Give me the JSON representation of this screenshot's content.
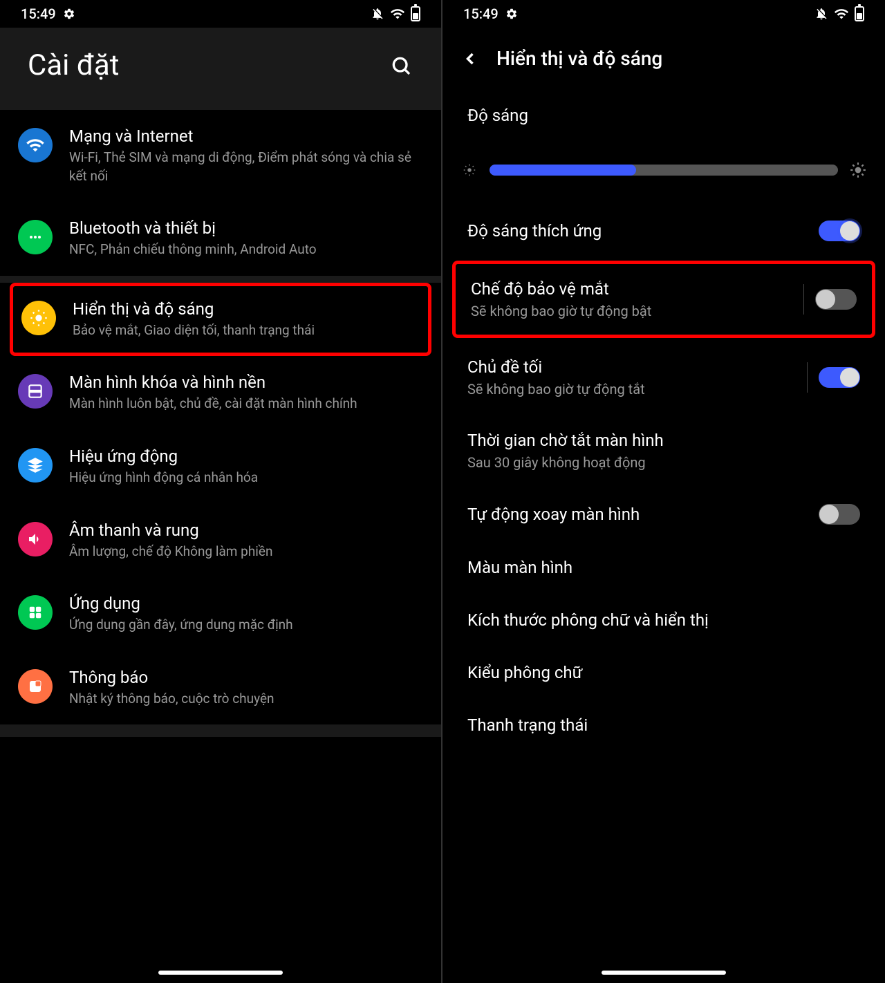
{
  "statusbar": {
    "time": "15:49"
  },
  "left": {
    "title": "Cài đặt",
    "items": [
      {
        "title": "Mạng và Internet",
        "subtitle": "Wi-Fi, Thẻ SIM và mạng di động, Điểm phát sóng và chia sẻ kết nối"
      },
      {
        "title": "Bluetooth và thiết bị",
        "subtitle": "NFC, Phản chiếu thông minh, Android Auto"
      },
      {
        "title": "Hiển thị và độ sáng",
        "subtitle": "Bảo vệ mắt, Giao diện tối, thanh trạng thái"
      },
      {
        "title": "Màn hình khóa và hình nền",
        "subtitle": "Màn hình luôn bật, chủ đề, cài đặt màn hình chính"
      },
      {
        "title": "Hiệu ứng động",
        "subtitle": "Hiệu ứng hình động cá nhân hóa"
      },
      {
        "title": "Âm thanh và rung",
        "subtitle": "Âm lượng, chế độ Không làm phiền"
      },
      {
        "title": "Ứng dụng",
        "subtitle": "Ứng dụng gần đây, ứng dụng mặc định"
      },
      {
        "title": "Thông báo",
        "subtitle": "Nhật ký thông báo, cuộc trò chuyện"
      }
    ]
  },
  "right": {
    "title": "Hiển thị và độ sáng",
    "brightness_label": "Độ sáng",
    "brightness_value": 42,
    "items": [
      {
        "title": "Độ sáng thích ứng",
        "subtitle": "",
        "toggle": true
      },
      {
        "title": "Chế độ bảo vệ mắt",
        "subtitle": "Sẽ không bao giờ tự động bật",
        "toggle": false
      },
      {
        "title": "Chủ đề tối",
        "subtitle": "Sẽ không bao giờ tự động tắt",
        "toggle": true
      },
      {
        "title": "Thời gian chờ tắt màn hình",
        "subtitle": "Sau 30 giây không hoạt động"
      },
      {
        "title": "Tự động xoay màn hình",
        "subtitle": "",
        "toggle": false
      },
      {
        "title": "Màu màn hình",
        "subtitle": ""
      },
      {
        "title": "Kích thước phông chữ và hiển thị",
        "subtitle": ""
      },
      {
        "title": "Kiểu phông chữ",
        "subtitle": ""
      },
      {
        "title": "Thanh trạng thái",
        "subtitle": ""
      }
    ]
  }
}
